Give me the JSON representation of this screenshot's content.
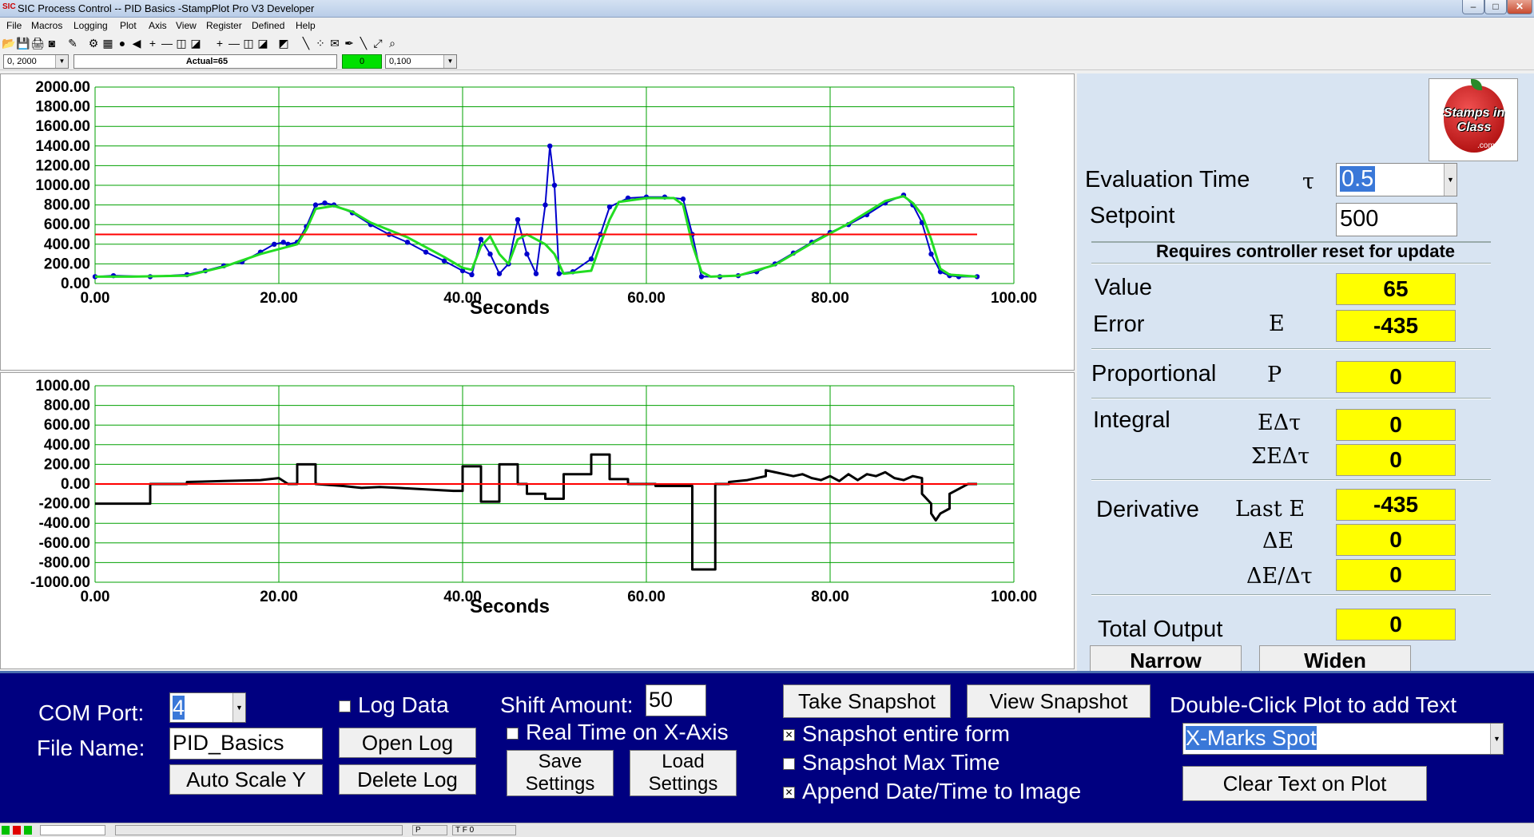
{
  "window": {
    "title": "SIC Process Control -- PID Basics -StampPlot Pro V3 Developer",
    "minimize": "–",
    "restore": "□",
    "close": "✕"
  },
  "menu": [
    "File",
    "Macros",
    "Logging",
    "Plot",
    "Axis",
    "View",
    "Register",
    "Defined",
    "Help"
  ],
  "toolbar": {
    "icons": [
      "open-icon",
      "save-icon",
      "print-icon",
      "camera-icon",
      "wand-icon",
      "chart-icon",
      "grid-icon",
      "stop-icon",
      "arrow-left-icon",
      "plus-icon",
      "minus-icon",
      "box-icon",
      "box-icon",
      "plus-icon",
      "minus-icon",
      "box-icon",
      "box-icon",
      "image-icon",
      "pen-icon",
      "scatter-icon",
      "note-icon",
      "marker-icon",
      "pencil-icon",
      "zoom-icon",
      "zoom-out-icon"
    ],
    "glyphs": [
      "📂",
      "💾",
      "🖨",
      "◙",
      "✎",
      "⚙",
      "▦",
      "●",
      "◀",
      "+",
      "—",
      "◫",
      "◪",
      "+",
      "—",
      "◫",
      "◪",
      "◩",
      "╲",
      "⁘",
      "✉",
      "✒",
      "╲",
      "⤢",
      "⌕"
    ]
  },
  "status_row": {
    "x_range": "0, 2000",
    "actual": "Actual=65",
    "counter": "0",
    "y_range": "0,100"
  },
  "colors": {
    "panel": "#d8e4f2",
    "bottom": "#000080",
    "highlight": "#ffff00",
    "grid": "#00a000",
    "setpoint_line": "#ff0000",
    "value_line": "#0000cc",
    "avg_line": "#22dd22"
  },
  "chart_data": [
    {
      "type": "line",
      "title": "",
      "xlabel": "Seconds",
      "ylabel": "",
      "xlim": [
        0,
        100
      ],
      "ylim": [
        0,
        2000
      ],
      "x_ticks": [
        "0.00",
        "20.00",
        "40.00",
        "60.00",
        "80.00",
        "100.00"
      ],
      "y_ticks": [
        "0.00",
        "200.00",
        "400.00",
        "600.00",
        "800.00",
        "1000.00",
        "1200.00",
        "1400.00",
        "1600.00",
        "1800.00",
        "2000.00"
      ],
      "grid": true,
      "series": [
        {
          "points": [
            [
              0,
              70
            ],
            [
              2,
              80
            ],
            [
              6,
              70
            ],
            [
              10,
              90
            ],
            [
              12,
              130
            ],
            [
              14,
              180
            ],
            [
              16,
              220
            ],
            [
              18,
              320
            ],
            [
              19.5,
              400
            ],
            [
              20.5,
              420
            ],
            [
              21,
              400
            ],
            [
              22,
              420
            ],
            [
              23,
              580
            ],
            [
              24,
              800
            ],
            [
              25,
              820
            ],
            [
              26,
              800
            ],
            [
              28,
              720
            ],
            [
              30,
              600
            ],
            [
              32,
              500
            ],
            [
              34,
              420
            ],
            [
              36,
              320
            ],
            [
              38,
              230
            ],
            [
              40,
              130
            ],
            [
              41,
              90
            ],
            [
              42,
              450
            ],
            [
              43,
              300
            ],
            [
              44,
              100
            ],
            [
              45,
              200
            ],
            [
              46,
              650
            ],
            [
              47,
              300
            ],
            [
              48,
              100
            ],
            [
              49,
              800
            ],
            [
              49.5,
              1400
            ],
            [
              50,
              1000
            ],
            [
              50.5,
              100
            ],
            [
              52,
              120
            ],
            [
              54,
              250
            ],
            [
              55,
              500
            ],
            [
              56,
              780
            ],
            [
              58,
              870
            ],
            [
              60,
              880
            ],
            [
              62,
              880
            ],
            [
              64,
              860
            ],
            [
              65,
              500
            ],
            [
              66,
              70
            ],
            [
              68,
              70
            ],
            [
              70,
              80
            ],
            [
              72,
              120
            ],
            [
              74,
              200
            ],
            [
              76,
              310
            ],
            [
              78,
              420
            ],
            [
              80,
              520
            ],
            [
              82,
              600
            ],
            [
              84,
              700
            ],
            [
              86,
              820
            ],
            [
              88,
              900
            ],
            [
              89,
              800
            ],
            [
              90,
              620
            ],
            [
              91,
              300
            ],
            [
              92,
              120
            ],
            [
              93,
              80
            ],
            [
              94,
              70
            ],
            [
              96,
              70
            ]
          ]
        },
        {
          "points": [
            [
              0,
              70
            ],
            [
              4,
              70
            ],
            [
              10,
              80
            ],
            [
              14,
              170
            ],
            [
              18,
              300
            ],
            [
              22,
              400
            ],
            [
              23,
              550
            ],
            [
              24,
              760
            ],
            [
              26,
              790
            ],
            [
              28,
              730
            ],
            [
              30,
              620
            ],
            [
              34,
              470
            ],
            [
              38,
              270
            ],
            [
              40,
              160
            ],
            [
              41,
              140
            ],
            [
              42,
              380
            ],
            [
              43,
              480
            ],
            [
              44,
              300
            ],
            [
              45,
              200
            ],
            [
              46,
              450
            ],
            [
              47,
              500
            ],
            [
              48,
              450
            ],
            [
              49,
              400
            ],
            [
              50,
              300
            ],
            [
              51,
              100
            ],
            [
              54,
              130
            ],
            [
              55,
              400
            ],
            [
              56,
              650
            ],
            [
              57,
              830
            ],
            [
              60,
              870
            ],
            [
              63,
              870
            ],
            [
              64,
              800
            ],
            [
              65,
              400
            ],
            [
              66,
              120
            ],
            [
              67,
              70
            ],
            [
              70,
              80
            ],
            [
              74,
              190
            ],
            [
              78,
              410
            ],
            [
              82,
              610
            ],
            [
              86,
              840
            ],
            [
              88,
              890
            ],
            [
              89,
              820
            ],
            [
              90,
              700
            ],
            [
              91,
              450
            ],
            [
              92,
              150
            ],
            [
              93,
              90
            ],
            [
              96,
              70
            ]
          ]
        },
        {
          "points": [
            [
              0,
              500
            ],
            [
              96,
              500
            ]
          ]
        }
      ]
    },
    {
      "type": "line",
      "title": "",
      "xlabel": "Seconds",
      "ylabel": "",
      "xlim": [
        0,
        100
      ],
      "ylim": [
        -1000,
        1000
      ],
      "x_ticks": [
        "0.00",
        "20.00",
        "40.00",
        "60.00",
        "80.00",
        "100.00"
      ],
      "y_ticks": [
        "-1000.00",
        "-800.00",
        "-600.00",
        "-400.00",
        "-200.00",
        "0.00",
        "200.00",
        "400.00",
        "600.00",
        "800.00",
        "1000.00"
      ],
      "grid": true,
      "series": [
        {
          "points": [
            [
              0,
              -200
            ],
            [
              6,
              -200
            ],
            [
              6,
              0
            ],
            [
              10,
              0
            ],
            [
              10,
              20
            ],
            [
              14,
              30
            ],
            [
              18,
              40
            ],
            [
              20,
              60
            ],
            [
              21,
              0
            ],
            [
              22,
              0
            ],
            [
              22,
              200
            ],
            [
              24,
              200
            ],
            [
              24,
              0
            ],
            [
              27,
              -20
            ],
            [
              29,
              -40
            ],
            [
              31,
              -30
            ],
            [
              33,
              -40
            ],
            [
              35,
              -50
            ],
            [
              37,
              -60
            ],
            [
              39,
              -70
            ],
            [
              40,
              -70
            ],
            [
              40,
              180
            ],
            [
              42,
              180
            ],
            [
              42,
              -180
            ],
            [
              44,
              -180
            ],
            [
              44,
              200
            ],
            [
              46,
              200
            ],
            [
              46,
              0
            ],
            [
              47,
              0
            ],
            [
              47,
              -100
            ],
            [
              49,
              -100
            ],
            [
              49,
              -150
            ],
            [
              51,
              -150
            ],
            [
              51,
              100
            ],
            [
              54,
              100
            ],
            [
              54,
              300
            ],
            [
              56,
              300
            ],
            [
              56,
              50
            ],
            [
              58,
              50
            ],
            [
              58,
              0
            ],
            [
              61,
              0
            ],
            [
              61,
              -20
            ],
            [
              65,
              -20
            ],
            [
              65,
              -870
            ],
            [
              67.5,
              -870
            ],
            [
              67.5,
              0
            ],
            [
              69,
              0
            ],
            [
              69,
              20
            ],
            [
              71,
              40
            ],
            [
              73,
              80
            ],
            [
              73,
              140
            ],
            [
              74,
              120
            ],
            [
              75,
              100
            ],
            [
              76,
              80
            ],
            [
              77,
              100
            ],
            [
              78,
              60
            ],
            [
              79,
              40
            ],
            [
              80,
              80
            ],
            [
              81,
              30
            ],
            [
              82,
              100
            ],
            [
              83,
              40
            ],
            [
              84,
              100
            ],
            [
              85,
              80
            ],
            [
              86,
              120
            ],
            [
              87,
              60
            ],
            [
              88,
              40
            ],
            [
              89,
              80
            ],
            [
              90,
              60
            ],
            [
              90,
              -100
            ],
            [
              91,
              -200
            ],
            [
              91,
              -300
            ],
            [
              91.5,
              -370
            ],
            [
              92,
              -300
            ],
            [
              93,
              -250
            ],
            [
              93,
              -100
            ],
            [
              94,
              -50
            ],
            [
              95,
              0
            ],
            [
              96,
              0
            ]
          ]
        },
        {
          "points": [
            [
              0,
              0
            ],
            [
              96,
              0
            ]
          ]
        }
      ]
    }
  ],
  "right_panel": {
    "logo_text": "Stamps in Class",
    "logo_sub": ".com",
    "eval_time_label": "Evaluation Time",
    "eval_time_symbol": "τ",
    "eval_time_value": "0.5",
    "setpoint_label": "Setpoint",
    "setpoint_value": "500",
    "reset_note": "Requires controller reset for update",
    "value_label": "Value",
    "value": "65",
    "error_label": "Error",
    "error_symbol": "E",
    "error_value": "-435",
    "proportional_label": "Proportional",
    "proportional_symbol": "P",
    "proportional_value": "0",
    "integral_label": "Integral",
    "integral_symbol1": "EΔτ",
    "integral_value1": "0",
    "integral_symbol2": "ΣEΔτ",
    "integral_value2": "0",
    "derivative_label": "Derivative",
    "derivative_symbol1": "Last E",
    "derivative_value1": "-435",
    "derivative_symbol2": "ΔE",
    "derivative_value2": "0",
    "derivative_symbol3": "ΔE/Δτ",
    "derivative_value3": "0",
    "total_label": "Total Output",
    "total_value": "0",
    "narrow_button": "Narrow",
    "widen_button": "Widen"
  },
  "bottom_panel": {
    "com_port_label": "COM Port:",
    "com_port_value": "4",
    "file_name_label": "File Name:",
    "file_name_value": "PID_Basics",
    "auto_scale_button": "Auto Scale Y",
    "log_data_label": "Log Data",
    "open_log_button": "Open Log",
    "delete_log_button": "Delete Log",
    "shift_amount_label": "Shift Amount:",
    "shift_amount_value": "50",
    "real_time_label": "Real Time on X-Axis",
    "save_settings_line1": "Save",
    "save_settings_line2": "Settings",
    "load_settings_line1": "Load",
    "load_settings_line2": "Settings",
    "take_snapshot_button": "Take Snapshot",
    "view_snapshot_button": "View Snapshot",
    "snapshot_form_label": "Snapshot entire form",
    "snapshot_max_label": "Snapshot Max Time",
    "append_date_label": "Append Date/Time to Image",
    "double_click_label": "Double-Click Plot to add Text",
    "text_select_value": "X-Marks Spot",
    "clear_text_button": "Clear Text on Plot"
  },
  "status_bar": {
    "p_field": "P",
    "tf_field": "T F 0"
  }
}
